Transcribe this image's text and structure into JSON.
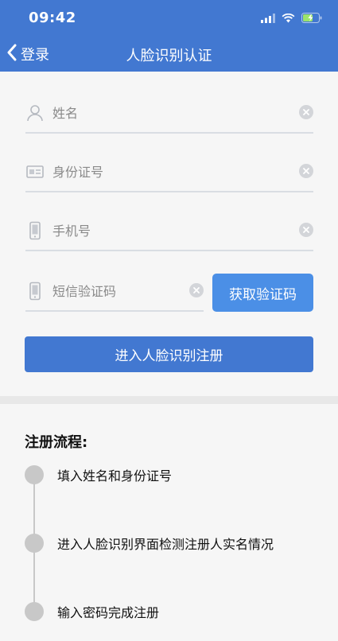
{
  "status_bar": {
    "time": "09:42"
  },
  "nav": {
    "back_label": "登录",
    "title": "人脸识别认证"
  },
  "form": {
    "name_placeholder": "姓名",
    "name_value": "",
    "id_placeholder": "身份证号",
    "id_value": "",
    "phone_placeholder": "手机号",
    "phone_value": "",
    "sms_placeholder": "短信验证码",
    "sms_value": "",
    "get_code_label": "获取验证码",
    "submit_label": "进入人脸识别注册"
  },
  "process": {
    "title": "注册流程:",
    "steps": [
      {
        "label": "填入姓名和身份证号"
      },
      {
        "label": "进入人脸识别界面检测注册人实名情况"
      },
      {
        "label": "输入密码完成注册"
      }
    ]
  },
  "colors": {
    "header_bg": "#4278d1",
    "primary_button": "#4278d1",
    "code_button": "#4b8fe6",
    "background": "#f6f6f6"
  }
}
